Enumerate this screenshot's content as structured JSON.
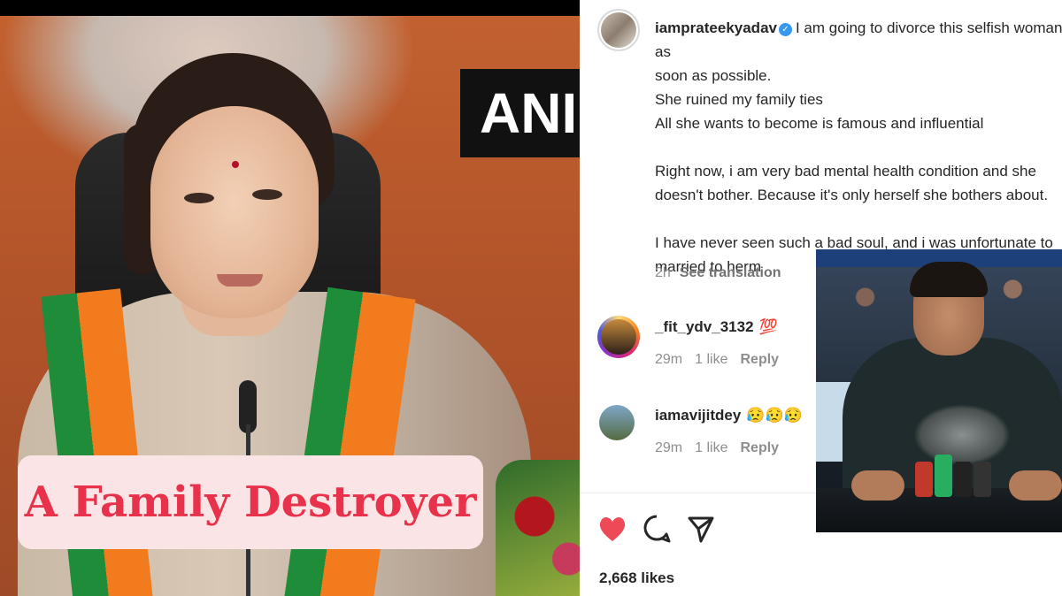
{
  "left_photo": {
    "board_text": "ANI",
    "caption": "A Family Destroyer"
  },
  "post": {
    "username": "iamprateekyadav",
    "caption_lines": [
      "I am going to divorce this selfish woman as",
      "soon as possible.",
      "She ruined my family ties",
      "All she wants to become is famous and influential",
      "",
      "Right now, i am very bad mental health condition and she",
      "doesn't bother. Because it's only herself she bothers about.",
      "",
      "I have never seen such a bad soul, and i was unfortunate to",
      "married to herm"
    ],
    "time": "2h",
    "see_translation": "See translation",
    "likes": "2,668 likes"
  },
  "comments": [
    {
      "username": "_fit_ydv_3132",
      "text": "💯",
      "time": "29m",
      "likes": "1 like",
      "reply": "Reply"
    },
    {
      "username": "iamavijitdey",
      "text": "😥😥😥",
      "time": "29m",
      "likes": "1 like",
      "reply": "Reply"
    }
  ],
  "actions": [
    "heart-icon",
    "comment-icon",
    "share-icon"
  ],
  "colors": {
    "caption_pink": "#e8324b",
    "caption_bg": "#fbe4e6",
    "like_red": "#ed4956",
    "verified_blue": "#3897f0"
  }
}
